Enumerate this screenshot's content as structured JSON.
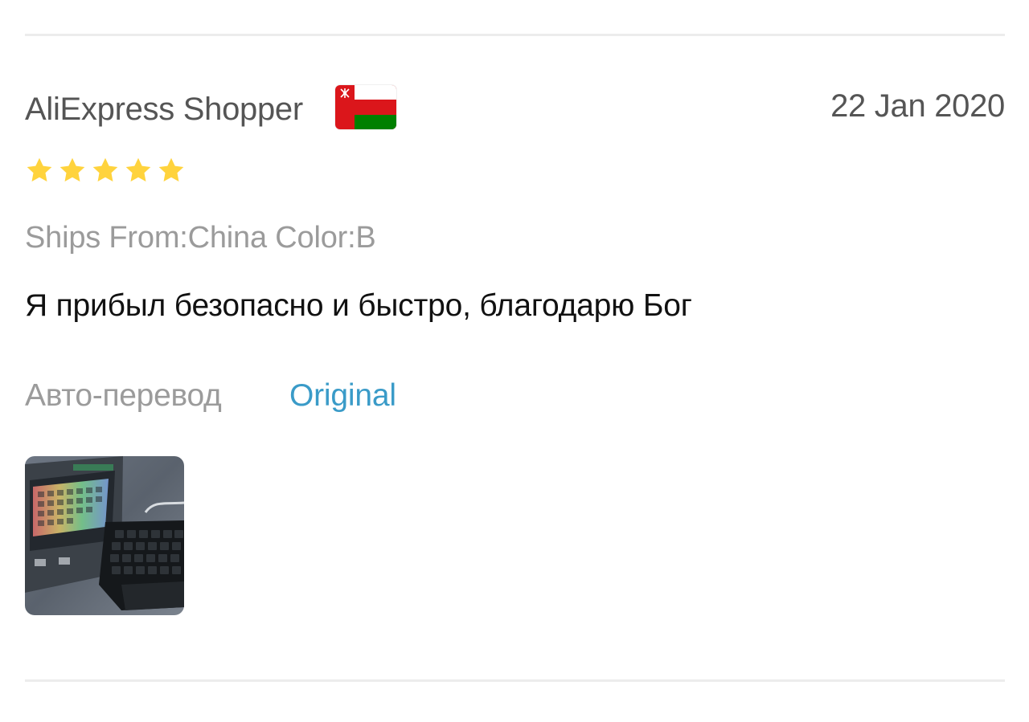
{
  "review": {
    "reviewer_name": "AliExpress Shopper",
    "country_flag": "oman-flag",
    "date": "22 Jan 2020",
    "rating": 5,
    "rating_max": 5,
    "star_color": "#ffd33d",
    "sku_info": "Ships From:China Color:B",
    "content": "Я прибыл безопасно и быстро, благодарю Бог",
    "auto_translate_label": "Авто-перевод",
    "original_link_label": "Original",
    "link_color": "#3a9bc8",
    "photos": [
      {
        "icon": "review-photo-keyboard"
      }
    ]
  }
}
